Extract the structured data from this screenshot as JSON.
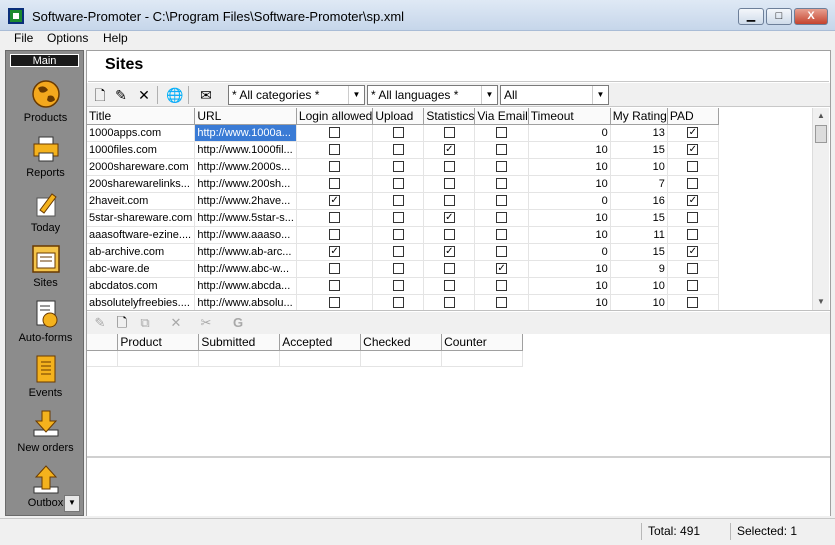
{
  "window": {
    "title": "Software-Promoter - C:\\Program Files\\Software-Promoter\\sp.xml",
    "min_glyph": "▁",
    "max_glyph": "□",
    "close_glyph": "X"
  },
  "menu": [
    "File",
    "Options",
    "Help"
  ],
  "sidebar": {
    "header": "Main",
    "items": [
      {
        "label": "Products",
        "icon": "globe-icon"
      },
      {
        "label": "Reports",
        "icon": "printer-icon"
      },
      {
        "label": "Today",
        "icon": "pencil-icon"
      },
      {
        "label": "Sites",
        "icon": "sites-window-icon"
      },
      {
        "label": "Auto-forms",
        "icon": "autoforms-icon"
      },
      {
        "label": "Events",
        "icon": "notepad-icon"
      },
      {
        "label": "New orders",
        "icon": "arrow-down-icon"
      },
      {
        "label": "Outbox",
        "icon": "arrow-up-icon"
      }
    ]
  },
  "page": {
    "title": "Sites"
  },
  "filters": {
    "categories": "* All categories *",
    "languages": "* All languages *",
    "other": "All"
  },
  "columns": [
    "Title",
    "URL",
    "Login allowed",
    "Upload",
    "Statistics",
    "Via Email",
    "Timeout",
    "My Rating",
    "PAD"
  ],
  "rows": [
    {
      "title": "1000apps.com",
      "url": "http://www.1000a...",
      "login": false,
      "upload": false,
      "stats": false,
      "email": false,
      "timeout": "0",
      "rating": "13",
      "pad": true
    },
    {
      "title": "1000files.com",
      "url": "http://www.1000fil...",
      "login": false,
      "upload": false,
      "stats": true,
      "email": false,
      "timeout": "10",
      "rating": "15",
      "pad": true
    },
    {
      "title": "2000shareware.com",
      "url": "http://www.2000s...",
      "login": false,
      "upload": false,
      "stats": false,
      "email": false,
      "timeout": "10",
      "rating": "10",
      "pad": false
    },
    {
      "title": "200sharewarelinks...",
      "url": "http://www.200sh...",
      "login": false,
      "upload": false,
      "stats": false,
      "email": false,
      "timeout": "10",
      "rating": "7",
      "pad": false
    },
    {
      "title": "2haveit.com",
      "url": "http://www.2have...",
      "login": true,
      "upload": false,
      "stats": false,
      "email": false,
      "timeout": "0",
      "rating": "16",
      "pad": true
    },
    {
      "title": "5star-shareware.com",
      "url": "http://www.5star-s...",
      "login": false,
      "upload": false,
      "stats": true,
      "email": false,
      "timeout": "10",
      "rating": "15",
      "pad": false
    },
    {
      "title": "aaasoftware-ezine....",
      "url": "http://www.aaaso...",
      "login": false,
      "upload": false,
      "stats": false,
      "email": false,
      "timeout": "10",
      "rating": "11",
      "pad": false
    },
    {
      "title": "ab-archive.com",
      "url": "http://www.ab-arc...",
      "login": true,
      "upload": false,
      "stats": true,
      "email": false,
      "timeout": "0",
      "rating": "15",
      "pad": true
    },
    {
      "title": "abc-ware.de",
      "url": "http://www.abc-w...",
      "login": false,
      "upload": false,
      "stats": false,
      "email": true,
      "timeout": "10",
      "rating": "9",
      "pad": false
    },
    {
      "title": "abcdatos.com",
      "url": "http://www.abcda...",
      "login": false,
      "upload": false,
      "stats": false,
      "email": false,
      "timeout": "10",
      "rating": "10",
      "pad": false
    },
    {
      "title": "absolutelyfreebies....",
      "url": "http://www.absolu...",
      "login": false,
      "upload": false,
      "stats": false,
      "email": false,
      "timeout": "10",
      "rating": "10",
      "pad": false
    }
  ],
  "submissions": {
    "columns": [
      "",
      "Product",
      "Submitted",
      "Accepted",
      "Checked",
      "Counter"
    ]
  },
  "status": {
    "total": "Total: 491",
    "selected": "Selected: 1"
  }
}
